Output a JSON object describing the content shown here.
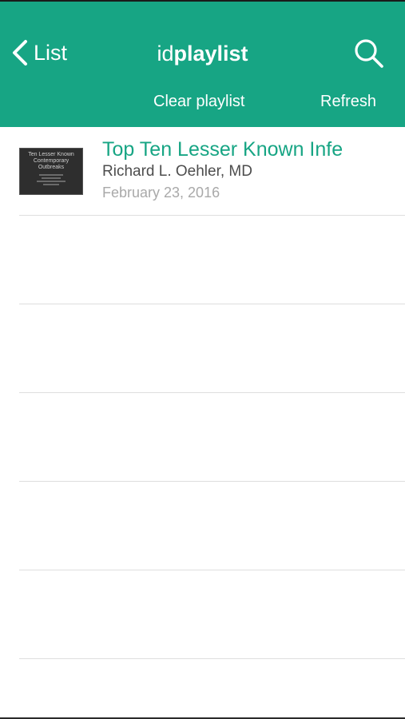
{
  "nav": {
    "back_label": "List",
    "title_light": "id",
    "title_bold": "playlist",
    "clear_label": "Clear playlist",
    "refresh_label": "Refresh",
    "back_icon": "chevron-left-icon",
    "search_icon": "search-icon"
  },
  "colors": {
    "brand": "#17a584",
    "title_text": "#17a584",
    "author_text": "#4d4d4d",
    "date_text": "#a9a9a9",
    "divider": "#dedede"
  },
  "playlist": {
    "items": [
      {
        "title": "Top Ten Lesser Known Infe",
        "author": "Richard L. Oehler, MD",
        "date": "February 23, 2016",
        "thumbnail": {
          "lines": [
            "Ten Lesser Known",
            "Contemporary",
            "Outbreaks"
          ]
        }
      }
    ],
    "empty_rows": 5
  }
}
